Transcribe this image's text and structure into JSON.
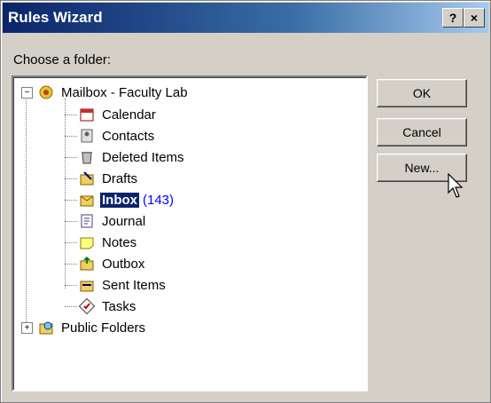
{
  "window": {
    "title": "Rules Wizard",
    "help_label": "?",
    "close_label": "×"
  },
  "prompt": "Choose a folder:",
  "tree": {
    "root": {
      "expander": "−",
      "label": "Mailbox - Faculty Lab"
    },
    "children": [
      {
        "label": "Calendar",
        "icon": "calendar-icon"
      },
      {
        "label": "Contacts",
        "icon": "contacts-icon"
      },
      {
        "label": "Deleted Items",
        "icon": "deleted-items-icon"
      },
      {
        "label": "Drafts",
        "icon": "drafts-icon"
      },
      {
        "label": "Inbox",
        "count": "(143)",
        "icon": "inbox-icon",
        "selected": true
      },
      {
        "label": "Journal",
        "icon": "journal-icon"
      },
      {
        "label": "Notes",
        "icon": "notes-icon"
      },
      {
        "label": "Outbox",
        "icon": "outbox-icon"
      },
      {
        "label": "Sent Items",
        "icon": "sent-items-icon"
      },
      {
        "label": "Tasks",
        "icon": "tasks-icon"
      }
    ],
    "public": {
      "expander": "+",
      "label": "Public Folders"
    }
  },
  "buttons": {
    "ok": "OK",
    "cancel": "Cancel",
    "new": "New..."
  },
  "colors": {
    "selection": "#0a246a",
    "count": "#0000ff",
    "title_start": "#0a246a"
  }
}
